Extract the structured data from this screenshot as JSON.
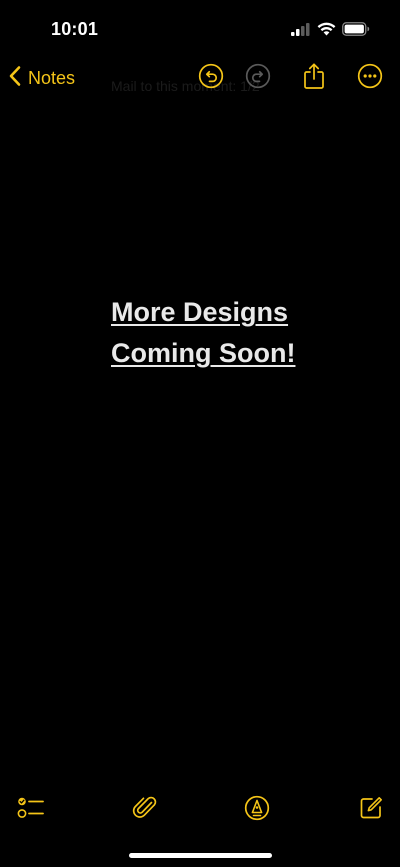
{
  "status_bar": {
    "time": "10:01"
  },
  "nav": {
    "back_label": "Notes",
    "ghost_title": "Mail to this moment: 1/2",
    "actions": [
      "undo-icon",
      "redo-icon",
      "share-icon",
      "more-icon"
    ]
  },
  "note": {
    "lines": [
      "More Designs",
      "Coming Soon!"
    ]
  },
  "toolbar": {
    "items": [
      "checklist-icon",
      "attachment-icon",
      "markup-pen-icon",
      "compose-icon"
    ]
  },
  "colors": {
    "accent": "#f5c518",
    "background": "#000000",
    "text": "#e9e9e9",
    "disabled": "#5a5a5a"
  }
}
